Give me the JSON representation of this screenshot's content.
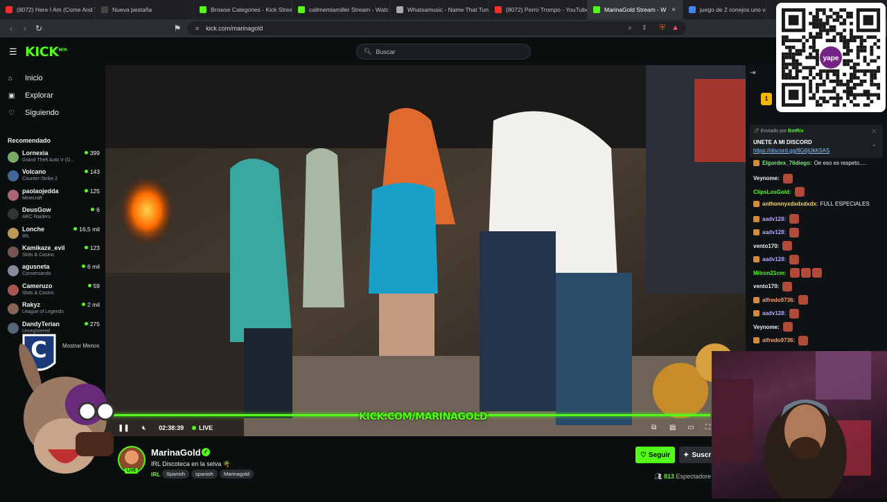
{
  "browser": {
    "tabs": [
      {
        "label": "(8072) Here I Am (Come And Ta",
        "fav": "#ff2d2d",
        "active": false
      },
      {
        "label": "Nueva pestaña",
        "fav": "#444",
        "active": false
      },
      {
        "label": "Browse Categories - Kick Strea",
        "fav": "#53fc18",
        "active": false
      },
      {
        "label": "callmemiamiller Stream - Watc",
        "fav": "#53fc18",
        "active": false
      },
      {
        "label": "Whatsamusic - Name That Tun",
        "fav": "#aaa",
        "active": false
      },
      {
        "label": "(8072) Perro Trompo - YouTube",
        "fav": "#ff2d2d",
        "active": false
      },
      {
        "label": "MarinaGold Stream - W",
        "fav": "#53fc18",
        "active": true
      },
      {
        "label": "juego de 2 conejos uno ver",
        "fav": "#4285f4",
        "active": false
      }
    ],
    "url": "kick.com/marinagold"
  },
  "header": {
    "logo": "KICK",
    "logo_badge": "BETA",
    "search_placeholder": "Buscar"
  },
  "sidebar": {
    "nav": [
      {
        "label": "Inicio",
        "icon": "home-icon",
        "glyph": "⌂"
      },
      {
        "label": "Explorar",
        "icon": "compass-icon",
        "glyph": "▣"
      },
      {
        "label": "Siguiendo",
        "icon": "heart-icon",
        "glyph": "♡"
      }
    ],
    "recommended_title": "Recomendado",
    "recommended": [
      {
        "name": "Lornexia",
        "category": "Grand Theft Auto V (G...",
        "viewers": "399",
        "color": "#7a6"
      },
      {
        "name": "Volcano",
        "category": "Counter-Strike 2",
        "viewers": "143",
        "color": "#469"
      },
      {
        "name": "paolaojedda",
        "category": "Minecraft",
        "viewers": "125",
        "color": "#a67"
      },
      {
        "name": "DeusGow",
        "category": "ARC Raiders",
        "viewers": "6",
        "color": "#333"
      },
      {
        "name": "Lonche",
        "category": "IRL",
        "viewers": "16,5 mil",
        "color": "#b95"
      },
      {
        "name": "Kamikaze_evil",
        "category": "Slots & Casino",
        "viewers": "123",
        "color": "#755"
      },
      {
        "name": "agusneta",
        "category": "Conversando",
        "viewers": "6 mil",
        "color": "#889"
      },
      {
        "name": "Cameruzo",
        "category": "Slots & Casino",
        "viewers": "59",
        "color": "#a55"
      },
      {
        "name": "Rakyz",
        "category": "League of Legends",
        "viewers": "2 mil",
        "color": "#865"
      },
      {
        "name": "DandyTerian",
        "category": "Unregistered",
        "viewers": "275",
        "color": "#567"
      }
    ],
    "show_less": "Mostrar Menos"
  },
  "player": {
    "time": "02:38:39",
    "live": "LIVE",
    "watermark": "KICK.COM/MARINAGOLD"
  },
  "stream": {
    "channel": "MarinaGold",
    "live_badge": "LIVE",
    "title": "IRL Discoteca en la selva 🌴",
    "category": "IRL",
    "tags": [
      "Spanish",
      "spanish",
      "Marinagold"
    ],
    "follow_label": "Seguir",
    "subscribe_label": "Suscr",
    "viewers_count": "813",
    "viewers_label": "Espectadore"
  },
  "chat": {
    "pinned_by_prefix": "Enviado por",
    "pinned_by": "BotRix",
    "pinned_message": "UNETE A MI DISCORD",
    "pinned_link": "https://discord.gg/8G6jUkK5AS",
    "messages": [
      {
        "user": "Elgordex_76diego:",
        "text": "Oe eso es respeto.....",
        "color": "#7fe07f",
        "badge": true,
        "emotes": 0
      },
      {
        "user": "Veynome:",
        "text": "",
        "color": "#f0f0f0",
        "badge": false,
        "emotes": 1
      },
      {
        "user": "ClipsLosGold:",
        "text": "",
        "color": "#53fc18",
        "badge": false,
        "emotes": 1
      },
      {
        "user": "anthonnyxdxdxdxdx:",
        "text": "FULL ESPECIALES",
        "color": "#f5d76e",
        "badge": true,
        "emotes": 0
      },
      {
        "user": "aadv128:",
        "text": "",
        "color": "#b9a4ff",
        "badge": true,
        "emotes": 1
      },
      {
        "user": "aadv128:",
        "text": "",
        "color": "#b9a4ff",
        "badge": true,
        "emotes": 1
      },
      {
        "user": "vento170:",
        "text": "",
        "color": "#f0f0f0",
        "badge": false,
        "emotes": 1
      },
      {
        "user": "aadv128:",
        "text": "",
        "color": "#b9a4ff",
        "badge": true,
        "emotes": 1
      },
      {
        "user": "Mitron21cm:",
        "text": "",
        "color": "#53fc18",
        "badge": false,
        "emotes": 3
      },
      {
        "user": "vento170:",
        "text": "",
        "color": "#f0f0f0",
        "badge": false,
        "emotes": 1
      },
      {
        "user": "alfredo9736:",
        "text": "",
        "color": "#ff9f6e",
        "badge": true,
        "emotes": 1
      },
      {
        "user": "aadv128:",
        "text": "",
        "color": "#b9a4ff",
        "badge": true,
        "emotes": 1
      },
      {
        "user": "Veynome:",
        "text": "",
        "color": "#f0f0f0",
        "badge": false,
        "emotes": 1
      },
      {
        "user": "alfredo9736:",
        "text": "",
        "color": "#ff9f6e",
        "badge": true,
        "emotes": 1
      }
    ]
  },
  "overlay": {
    "qr_brand": "yape"
  },
  "colors": {
    "accent": "#53fc18",
    "background": "#0b0e0f"
  }
}
